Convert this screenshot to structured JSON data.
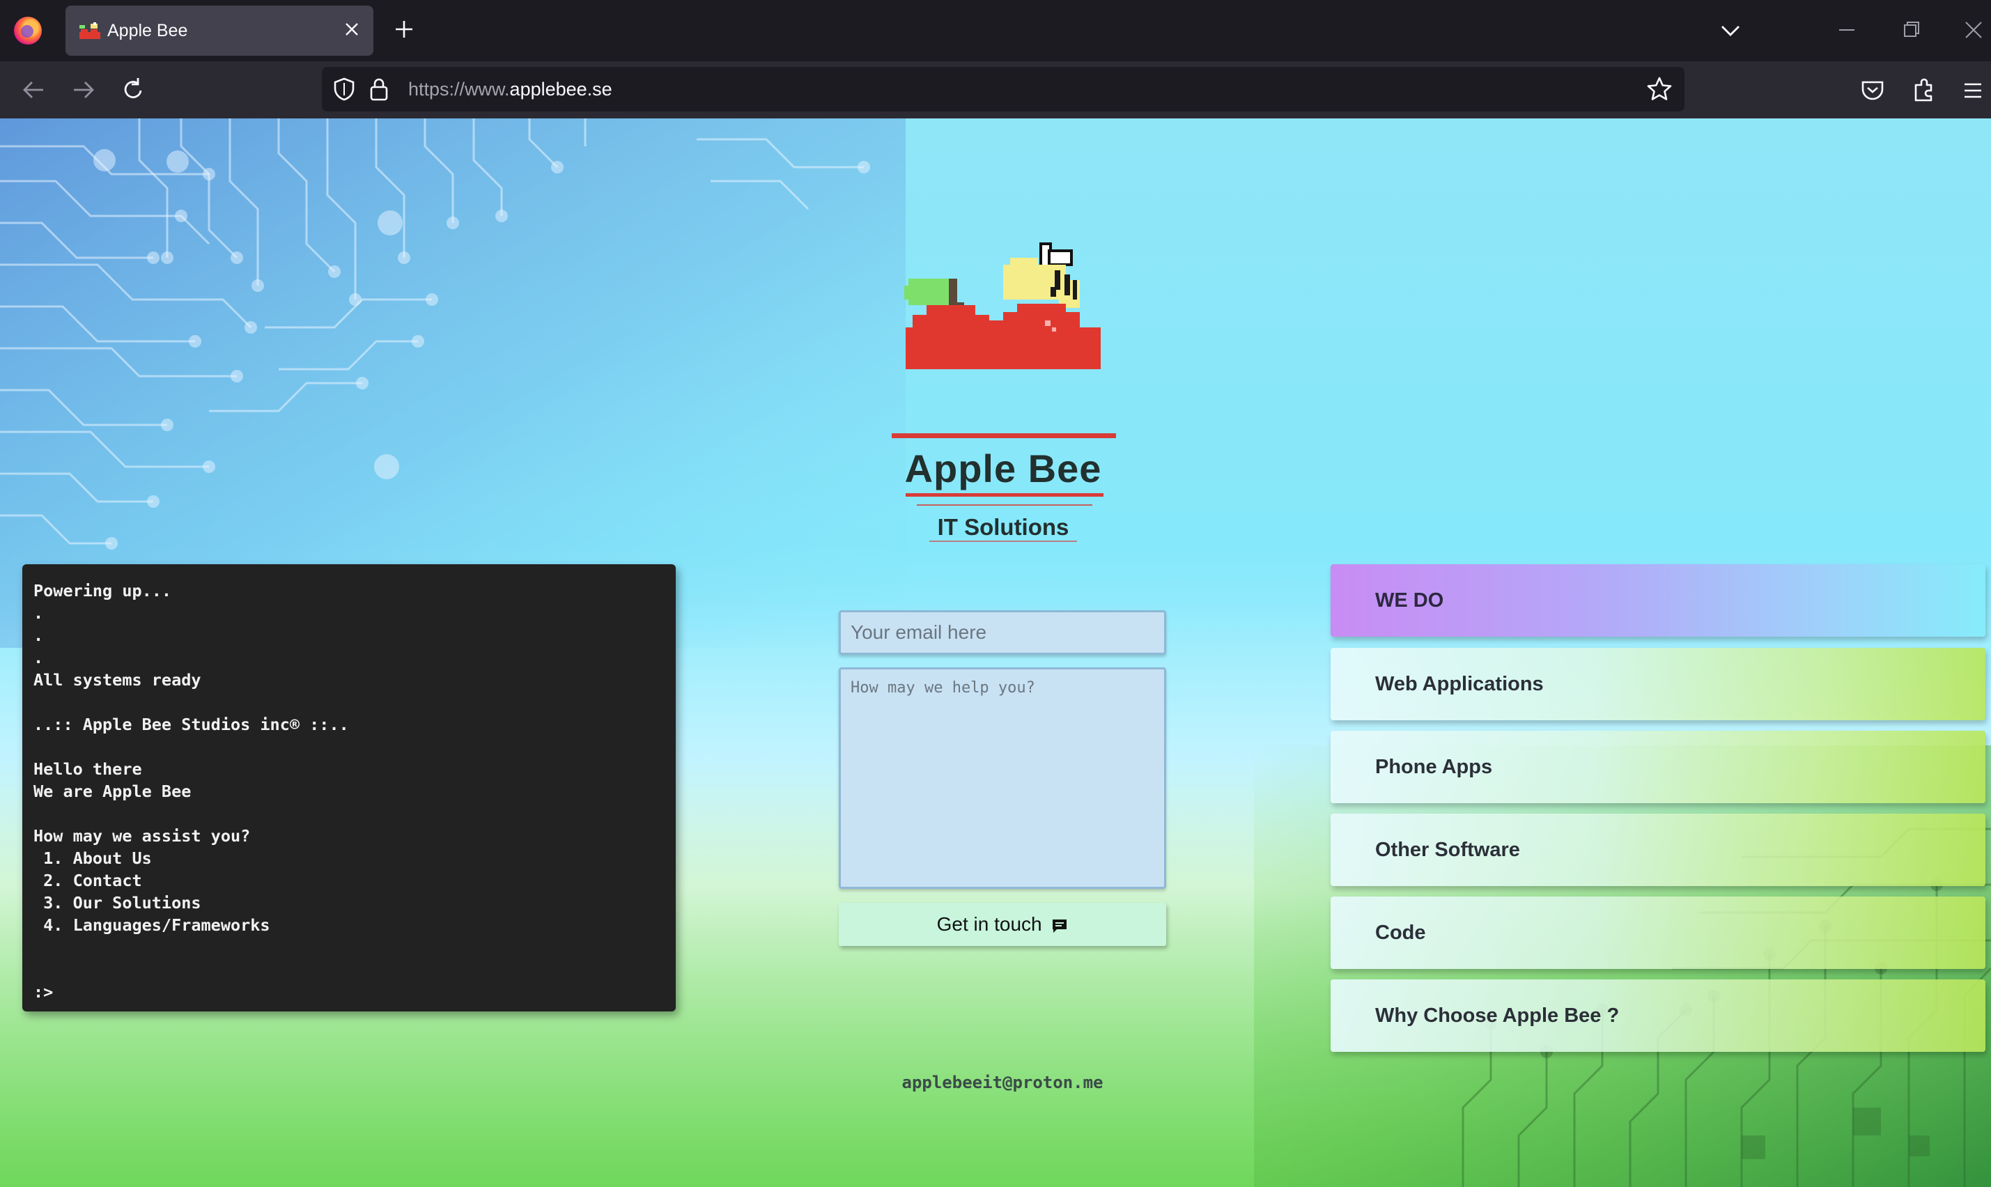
{
  "browser": {
    "tab_title": "Apple Bee",
    "url_prefix": "https://www.",
    "url_domain": "applebee.se"
  },
  "brand": {
    "name": "Apple Bee",
    "subtitle": "IT Solutions"
  },
  "terminal": {
    "lines": [
      "Powering up...",
      ".",
      ".",
      ".",
      "All systems ready",
      "",
      "..:: Apple Bee Studios inc® ::..",
      "",
      "Hello there",
      "We are Apple Bee",
      "",
      "How may we assist you?",
      " 1. About Us",
      " 2. Contact",
      " 3. Our Solutions",
      " 4. Languages/Frameworks",
      "",
      "",
      ":>"
    ]
  },
  "contact": {
    "email_placeholder": "Your email here",
    "message_placeholder": "How may we help you?",
    "send_label": "Get in touch",
    "footer_email": "applebeeit@proton.me"
  },
  "services": {
    "header": "WE DO",
    "items": [
      "Web Applications",
      "Phone Apps",
      "Other Software",
      "Code",
      "Why Choose Apple Bee ?"
    ]
  },
  "colors": {
    "terminal_bg": "#222222",
    "accent_red": "#d93b36",
    "menu_header_purple": "#c88cf4",
    "input_bg": "#c8e2f4",
    "button_bg": "#c8f5dc"
  }
}
